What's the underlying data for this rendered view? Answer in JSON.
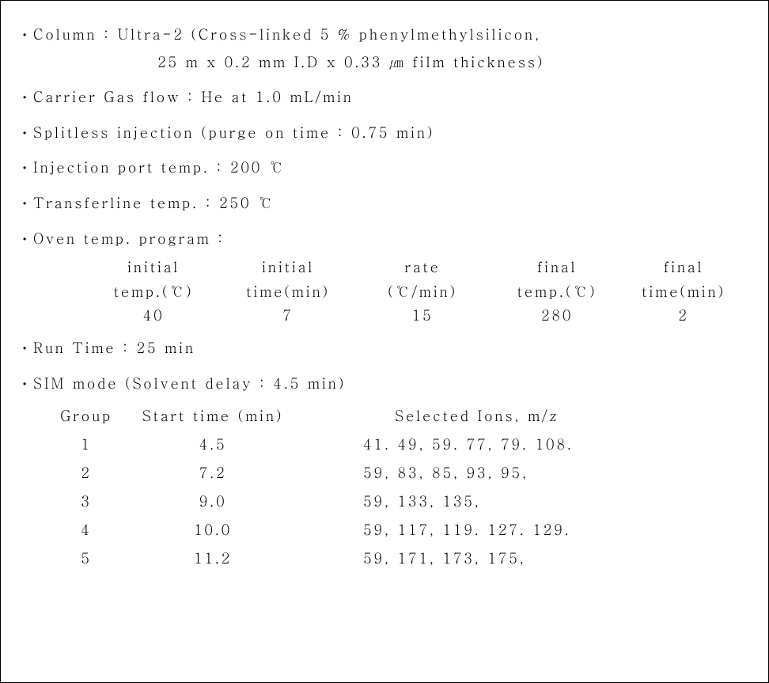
{
  "column": {
    "label": "Column :",
    "value": "Ultra-2 (Cross-linked 5 % phenylmethylsilicon,",
    "value2": "25 m x 0.2 mm I.D x 0.33 ㎛ film thickness)"
  },
  "carrier": {
    "label": "Carrier Gas flow :",
    "value": "He at 1.0 mL/min"
  },
  "splitless": {
    "text": "Splitless injection (purge on time : 0.75 min)"
  },
  "injport": {
    "label": "Injection port temp. :",
    "value": "200 ℃"
  },
  "transferline": {
    "label": "Transferline temp. :",
    "value": "250 ℃"
  },
  "oven": {
    "label": "Oven temp. program :",
    "headers1": [
      "initial",
      "initial",
      "rate",
      "final",
      "final"
    ],
    "headers2": [
      "temp.(℃)",
      "time(min)",
      "(℃/min)",
      "temp.(℃)",
      "time(min)"
    ],
    "values": [
      "40",
      "7",
      "15",
      "280",
      "2"
    ]
  },
  "runtime": {
    "label": "Run Time :",
    "value": "25 min"
  },
  "sim": {
    "label": "SIM mode (Solvent delay : 4.5 min)",
    "headers": {
      "group": "Group",
      "start": "Start time (min)",
      "ions": "Selected Ions, m/z"
    },
    "rows": [
      {
        "group": "1",
        "start": "4.5",
        "ions": "41. 49, 59. 77, 79. 108."
      },
      {
        "group": "2",
        "start": "7.2",
        "ions": "59, 83, 85, 93, 95,"
      },
      {
        "group": "3",
        "start": "9.0",
        "ions": "59, 133, 135,"
      },
      {
        "group": "4",
        "start": "10.0",
        "ions": "59, 117, 119. 127. 129."
      },
      {
        "group": "5",
        "start": "11.2",
        "ions": "59, 171, 173, 175,"
      }
    ]
  }
}
